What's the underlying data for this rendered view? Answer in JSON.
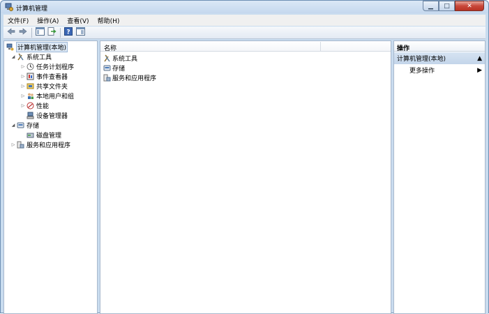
{
  "window": {
    "title": "计算机管理"
  },
  "menu": [
    "文件(F)",
    "操作(A)",
    "查看(V)",
    "帮助(H)"
  ],
  "toolbar": {
    "buttons": [
      "back-arrow-icon",
      "forward-arrow-icon",
      "show-hide-tree-icon",
      "export-list-icon",
      "help-icon",
      "properties-icon"
    ]
  },
  "tree": {
    "root": "计算机管理(本地)",
    "system_tools": "系统工具",
    "task_scheduler": "任务计划程序",
    "event_viewer": "事件查看器",
    "shared_folders": "共享文件夹",
    "local_users": "本地用户和组",
    "performance": "性能",
    "device_manager": "设备管理器",
    "storage": "存储",
    "disk_mgmt": "磁盘管理",
    "services_apps": "服务和应用程序"
  },
  "list": {
    "header_name": "名称",
    "items": [
      "系统工具",
      "存储",
      "服务和应用程序"
    ]
  },
  "actions": {
    "header": "操作",
    "section": "计算机管理(本地)",
    "more": "更多操作"
  },
  "colors": {
    "frame": "#c9dcef",
    "selection": "#dce8f5",
    "section": "#c3d5ea"
  }
}
